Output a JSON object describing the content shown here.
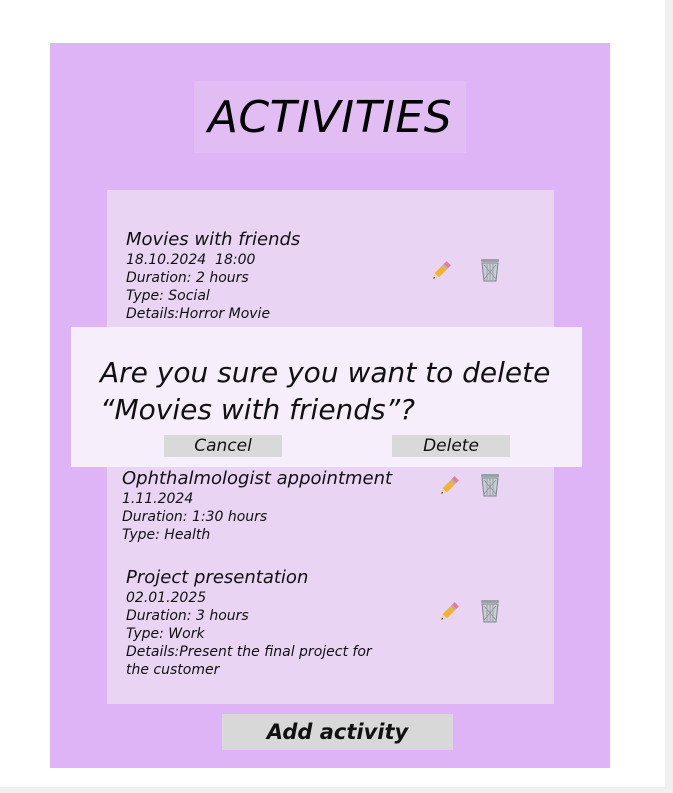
{
  "header": {
    "title": "ACTIVITIES"
  },
  "activities": [
    {
      "name": "Movies with friends",
      "datetime": "18.10.2024  18:00",
      "duration": "Duration: 2 hours",
      "type": "Type: Social",
      "details": "Details:Horror Movie"
    },
    {
      "name": "Ophthalmologist appointment",
      "datetime": "1.11.2024",
      "duration": "Duration: 1:30 hours",
      "type": "Type: Health"
    },
    {
      "name": "Project presentation",
      "datetime": "02.01.2025",
      "duration": "Duration: 3 hours",
      "type": "Type: Work",
      "details": "Details:Present the final project for the customer"
    }
  ],
  "icons": {
    "edit": "pencil-icon",
    "delete": "trash-can-icon"
  },
  "dialog": {
    "question_line1": "Are you sure you want to delete",
    "question_line2": "“Movies with friends”?",
    "cancel_label": "Cancel",
    "delete_label": "Delete"
  },
  "footer": {
    "add_label": "Add activity"
  },
  "colors": {
    "panel": "#dfb4f6",
    "list": "#e9d5f3",
    "dialog": "#f6eefb",
    "button": "#d9d9d9"
  }
}
